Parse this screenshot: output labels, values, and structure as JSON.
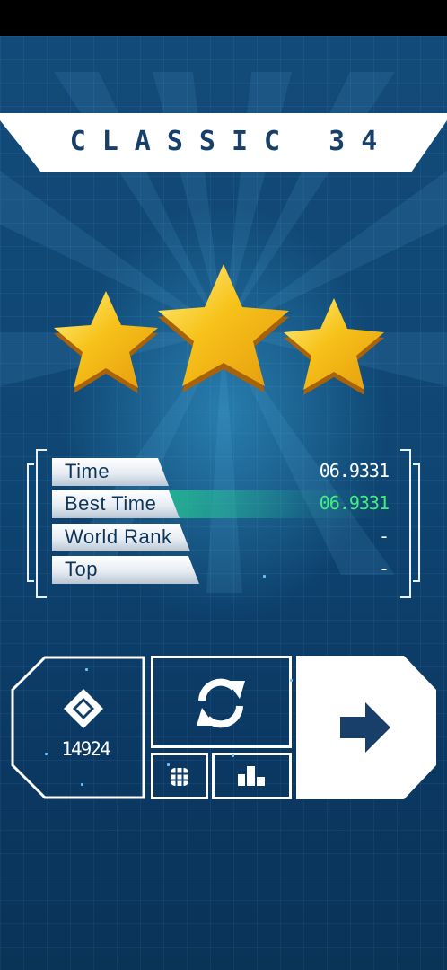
{
  "level": {
    "title": "CLASSIC 34"
  },
  "stars": {
    "earned": 3,
    "total": 3
  },
  "stats": [
    {
      "label": "Time",
      "value": "06.9331"
    },
    {
      "label": "Best Time",
      "value": "06.9331"
    },
    {
      "label": "World Rank",
      "value": "-"
    },
    {
      "label": "Top",
      "value": "-"
    }
  ],
  "actions": {
    "score": "14924",
    "score_icon": "diamond-icon",
    "retry_icon": "retry-icon",
    "levels_icon": "grid-icon",
    "leaderboard_icon": "bar-chart-icon",
    "next_icon": "arrow-right-icon"
  },
  "colors": {
    "best_time": "#3ff07f",
    "title": "#173f6a",
    "star": "#f7c21a"
  }
}
